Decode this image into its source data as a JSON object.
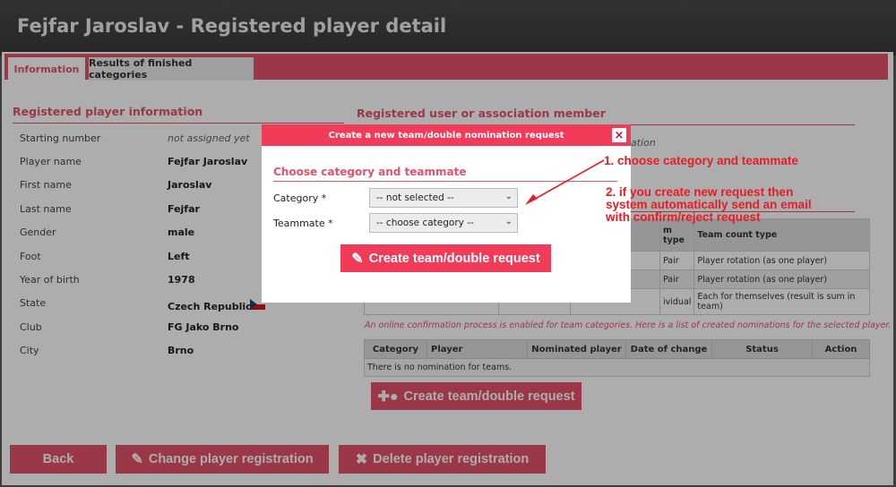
{
  "page": {
    "title": "Fejfar Jaroslav - Registered player detail"
  },
  "tabs": [
    {
      "label": "Information",
      "active": true
    },
    {
      "label": "Results of finished categories",
      "active": false
    }
  ],
  "player_section": {
    "title": "Registered player information",
    "rows": [
      {
        "label": "Starting number",
        "value": "not assigned yet"
      },
      {
        "label": "Player name",
        "value": "Fejfar Jaroslav"
      },
      {
        "label": "First name",
        "value": "Jaroslav"
      },
      {
        "label": "Last name",
        "value": "Fejfar"
      },
      {
        "label": "Gender",
        "value": "male"
      },
      {
        "label": "Foot",
        "value": "Left"
      },
      {
        "label": "Year of birth",
        "value": "1978"
      },
      {
        "label": "State",
        "value": "Czech Republic"
      },
      {
        "label": "Club",
        "value": "FG Jako Brno"
      },
      {
        "label": "City",
        "value": "Brno"
      }
    ]
  },
  "member_section": {
    "title": "Registered user or association member",
    "partial_value": "ation"
  },
  "team_table": {
    "headers": [
      "m type",
      "Team count type"
    ],
    "rows": [
      [
        "Pair",
        "Player rotation (as one player)"
      ],
      [
        "Pair",
        "Player rotation (as one player)"
      ],
      [
        "ividual",
        "Each for themselves (result is sum in team)"
      ]
    ]
  },
  "notice": "An online confirmation process is enabled for team categories. Here is a list of created nominations for the selected player.",
  "nomination_table": {
    "headers": [
      "Category",
      "Player",
      "Nominated player",
      "Date of change",
      "Status",
      "Action"
    ],
    "empty_text": "There is no nomination for teams."
  },
  "buttons": {
    "create_request": "Create team/double request",
    "back": "Back",
    "change": "Change player registration",
    "delete": "Delete player registration"
  },
  "modal": {
    "title": "Create a new team/double nomination request",
    "close": "×",
    "section_title": "Choose category and teammate",
    "category_label": "Category *",
    "category_value": "-- not selected --",
    "teammate_label": "Teammate *",
    "teammate_value": "-- choose category --",
    "submit": "Create team/double request"
  },
  "annotations": {
    "step1": "1. choose category and teammate",
    "step2_line1": "2. if you create new request then",
    "step2_line2": "system automatically send an email",
    "step2_line3": "with confirm/reject request"
  },
  "colors": {
    "accent": "#e3536b",
    "modal_header": "#f23a59",
    "annotation": "#e81c24"
  }
}
